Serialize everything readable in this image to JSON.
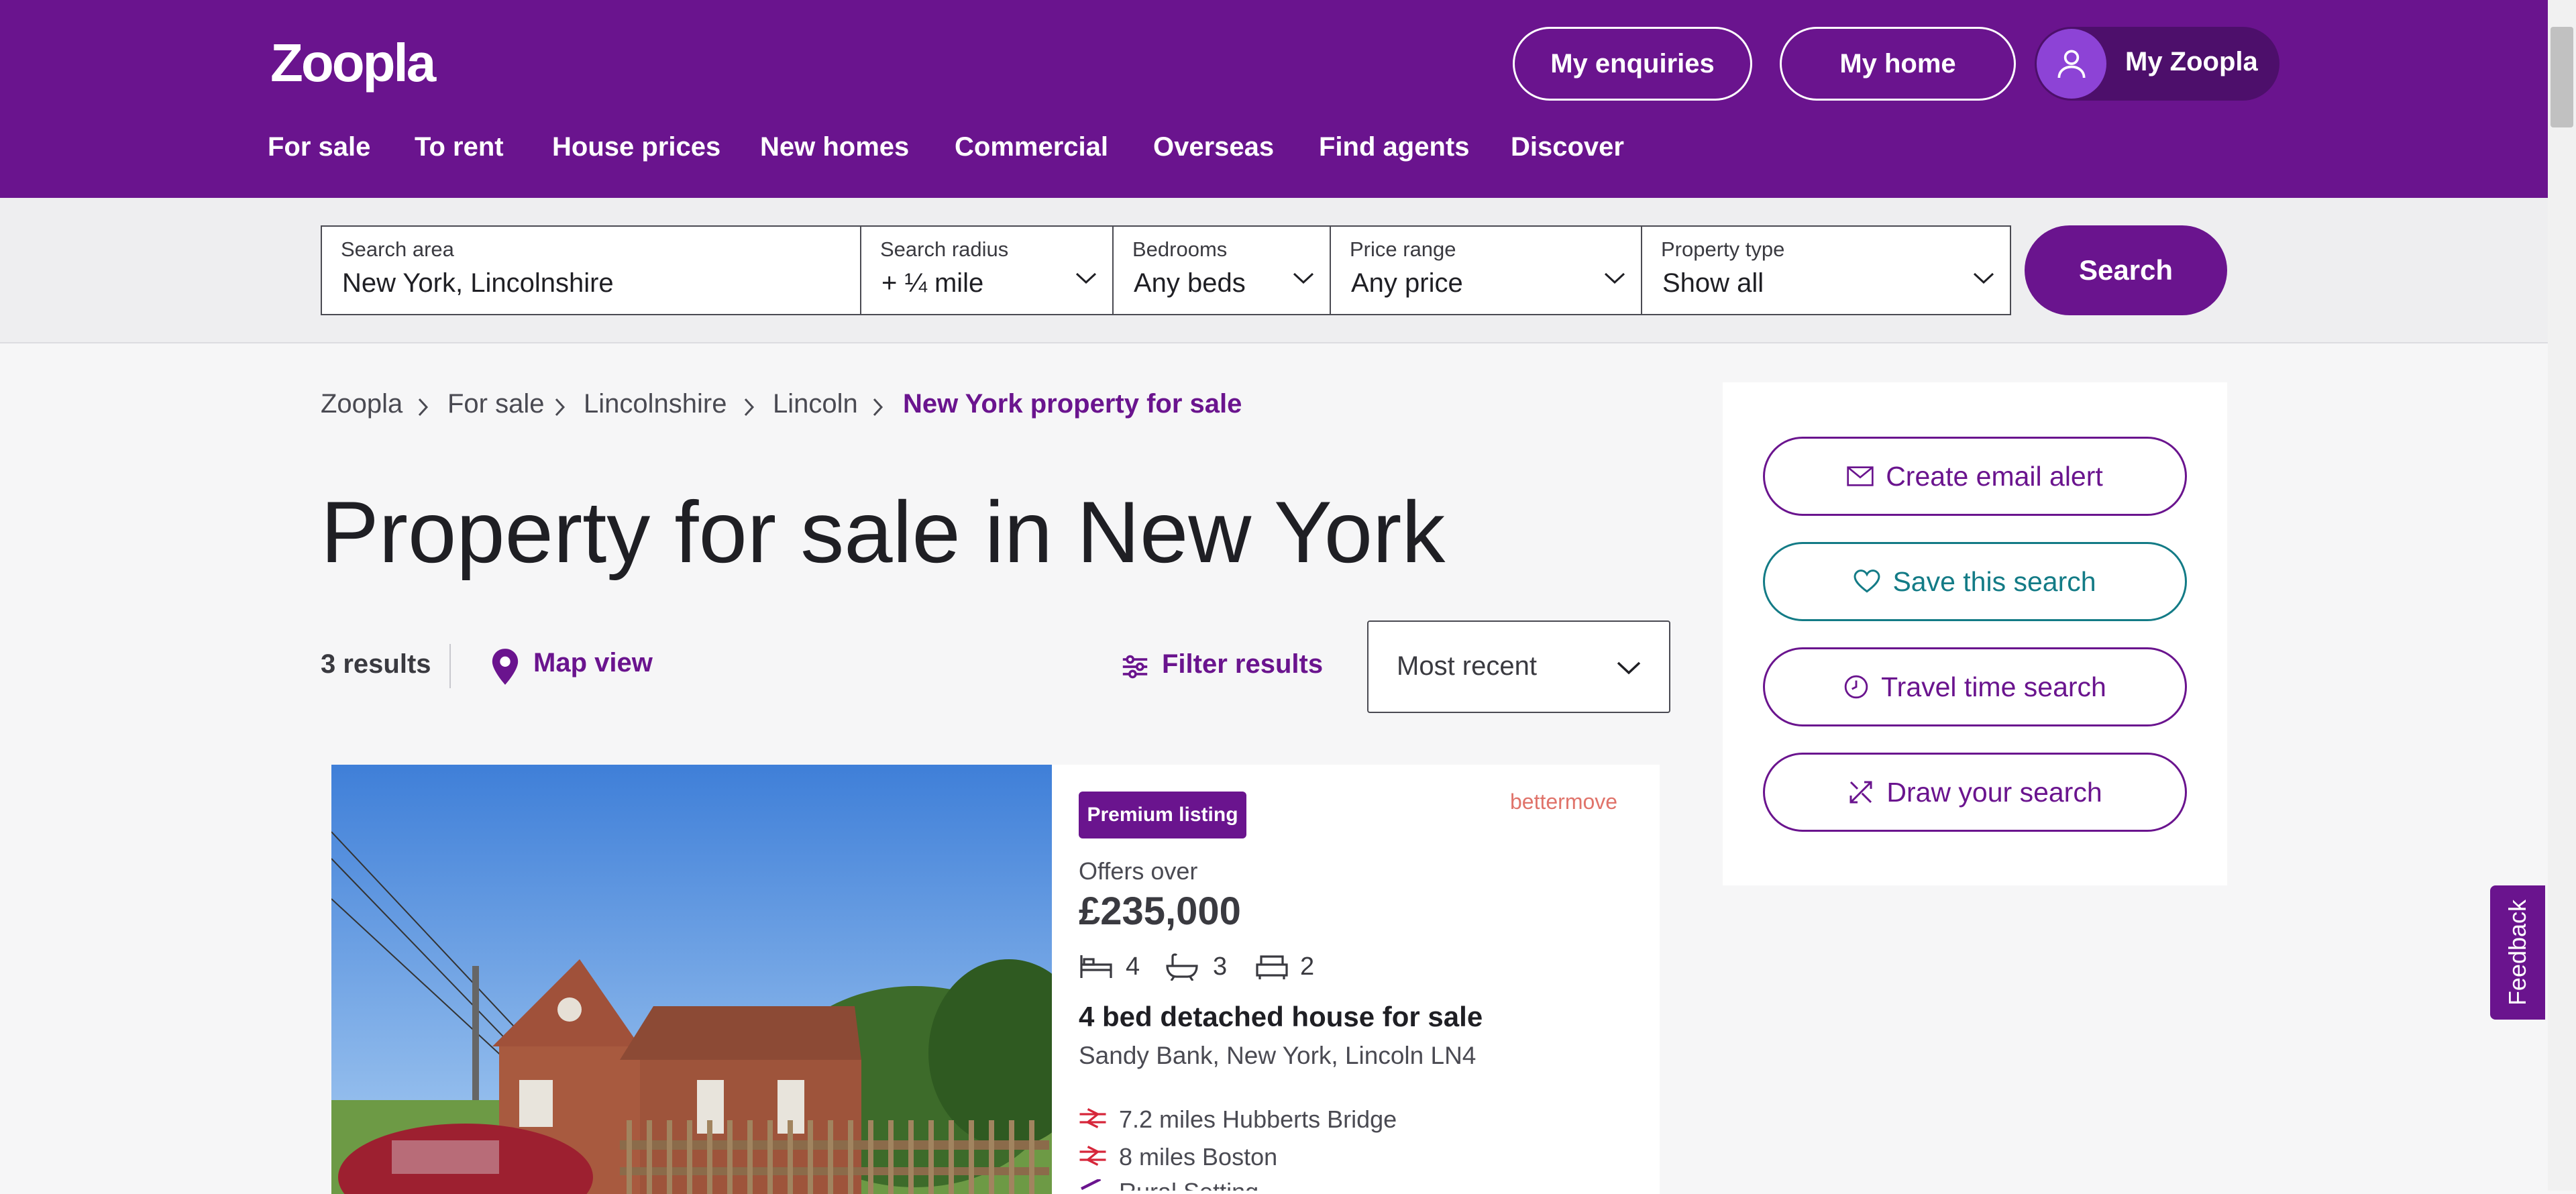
{
  "header": {
    "logo": "Zoopla",
    "buttons": {
      "enquiries": "My enquiries",
      "home": "My home",
      "account": "My Zoopla"
    },
    "nav": [
      "For sale",
      "To rent",
      "House prices",
      "New homes",
      "Commercial",
      "Overseas",
      "Find agents",
      "Discover"
    ]
  },
  "search": {
    "area": {
      "label": "Search area",
      "value": "New York, Lincolnshire"
    },
    "radius": {
      "label": "Search radius",
      "value": "+ ¼ mile"
    },
    "bedrooms": {
      "label": "Bedrooms",
      "value": "Any beds"
    },
    "price": {
      "label": "Price range",
      "value": "Any price"
    },
    "type": {
      "label": "Property type",
      "value": "Show all"
    },
    "button": "Search"
  },
  "breadcrumb": [
    "Zoopla",
    "For sale",
    "Lincolnshire",
    "Lincoln",
    "New York property for sale"
  ],
  "page_title": "Property for sale in New York",
  "toolbar": {
    "results": "3 results",
    "map_view": "Map view",
    "filter": "Filter results",
    "sort": "Most recent"
  },
  "listing": {
    "badge": "Premium listing",
    "agent": "bettermove",
    "price_prefix": "Offers over",
    "price": "£235,000",
    "beds": "4",
    "baths": "3",
    "receptions": "2",
    "title": "4 bed detached house for sale",
    "address": "Sandy Bank, New York, Lincoln LN4",
    "stations": [
      "7.2 miles Hubberts Bridge",
      "8 miles Boston"
    ],
    "extra": "Rural Setting"
  },
  "sidebar": {
    "email_alert": "Create email alert",
    "save_search": "Save this search",
    "travel_time": "Travel time search",
    "draw": "Draw your search"
  },
  "feedback": "Feedback",
  "colors": {
    "brand": "#6a148e",
    "teal": "#137b86",
    "accent_red": "#e0736a"
  }
}
